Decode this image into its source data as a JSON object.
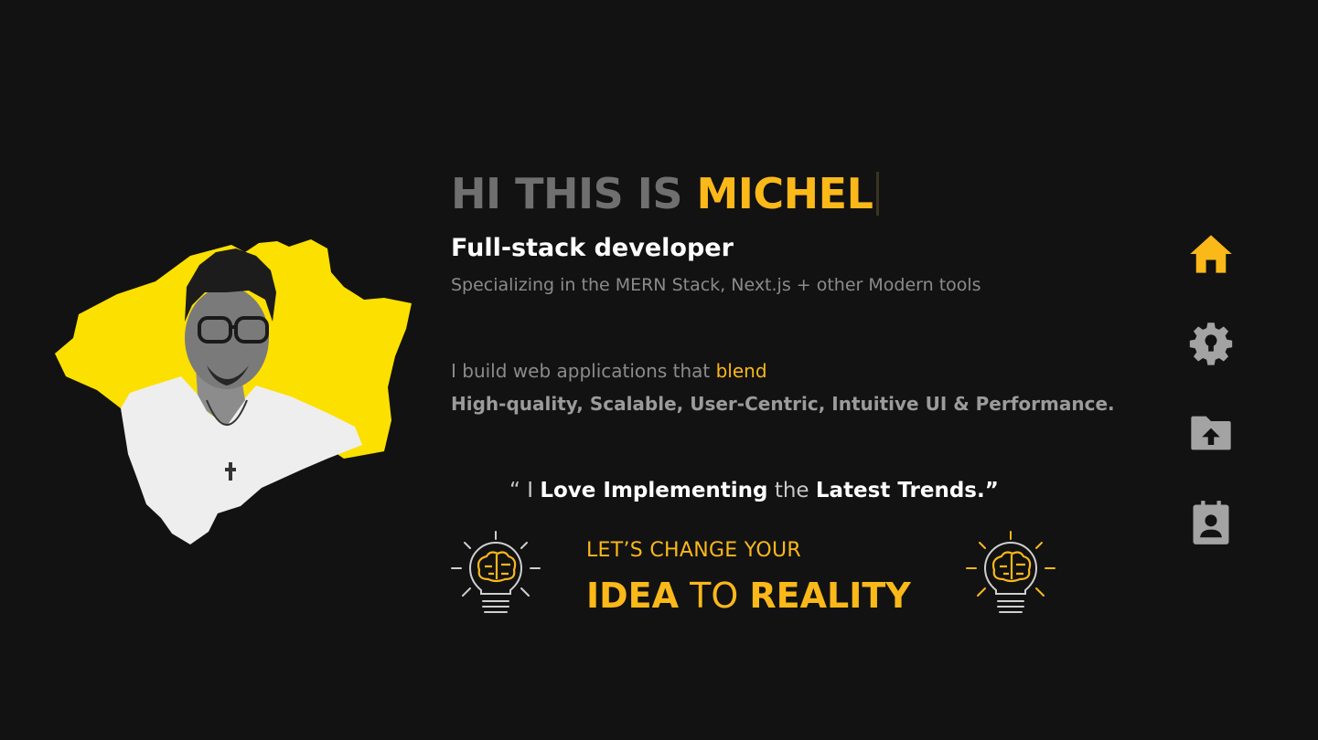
{
  "hero": {
    "greeting": "HI THIS IS",
    "name": "MICHEL",
    "role": "Full-stack developer",
    "specialization": "Specializing in the MERN Stack, Next.js + other Modern tools",
    "build_prefix": "I build web applications that",
    "build_highlight": "blend",
    "qualities": "High-quality, Scalable, User-Centric, Intuitive UI & Performance."
  },
  "quote": {
    "open": "“ I",
    "w1": "Love Implementing",
    "w2": "the",
    "w3": "Latest Trends.”"
  },
  "cta": {
    "line1": "LET’S CHANGE YOUR",
    "idea": "IDEA",
    "to": "TO",
    "reality": "REALITY"
  },
  "nav": [
    {
      "icon": "home-icon",
      "active": true
    },
    {
      "icon": "gear-icon",
      "active": false
    },
    {
      "icon": "folder-icon",
      "active": false
    },
    {
      "icon": "contact-icon",
      "active": false
    }
  ],
  "colors": {
    "accent": "#fbb819",
    "background": "#121212",
    "muted_text": "#8b8b8b",
    "inactive_icon": "#a3a3a3",
    "portrait_splash": "#fce000"
  }
}
